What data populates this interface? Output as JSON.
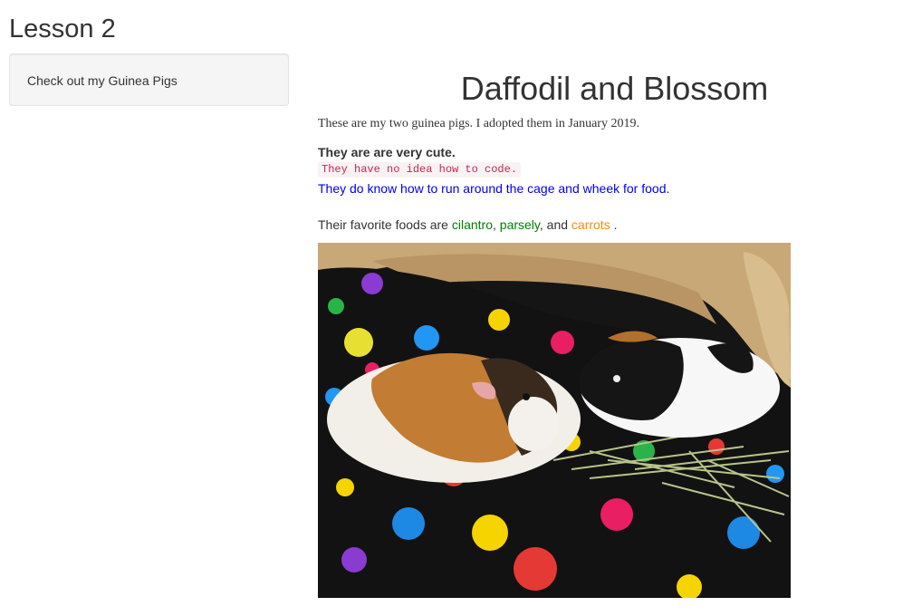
{
  "page": {
    "title": "Lesson 2"
  },
  "sidebar": {
    "panel_text": "Check out my Guinea Pigs"
  },
  "main": {
    "heading": "Daffodil and Blossom",
    "intro": "These are my two guinea pigs. I adopted them in January 2019.",
    "bold_line": "They are are very cute.",
    "code_line": "They have no idea how to code.",
    "blue_line": "They do know how to run around the cage and wheek for food.",
    "foods": {
      "prefix": "Their favorite foods are ",
      "food1": "cilantro",
      "sep1": ", ",
      "food2": "parsely",
      "sep2": ", and ",
      "food3": "carrots",
      "suffix": " ."
    }
  },
  "photo": {
    "description_icon": "guinea-pigs-photo"
  },
  "colors": {
    "text": "#333333",
    "blue_text": "#0000ee",
    "green_text": "#008000",
    "orange_text": "#ff8c00",
    "code_text": "#c7254e",
    "code_bg": "#f9f2f4",
    "panel_bg": "#f5f5f5"
  }
}
